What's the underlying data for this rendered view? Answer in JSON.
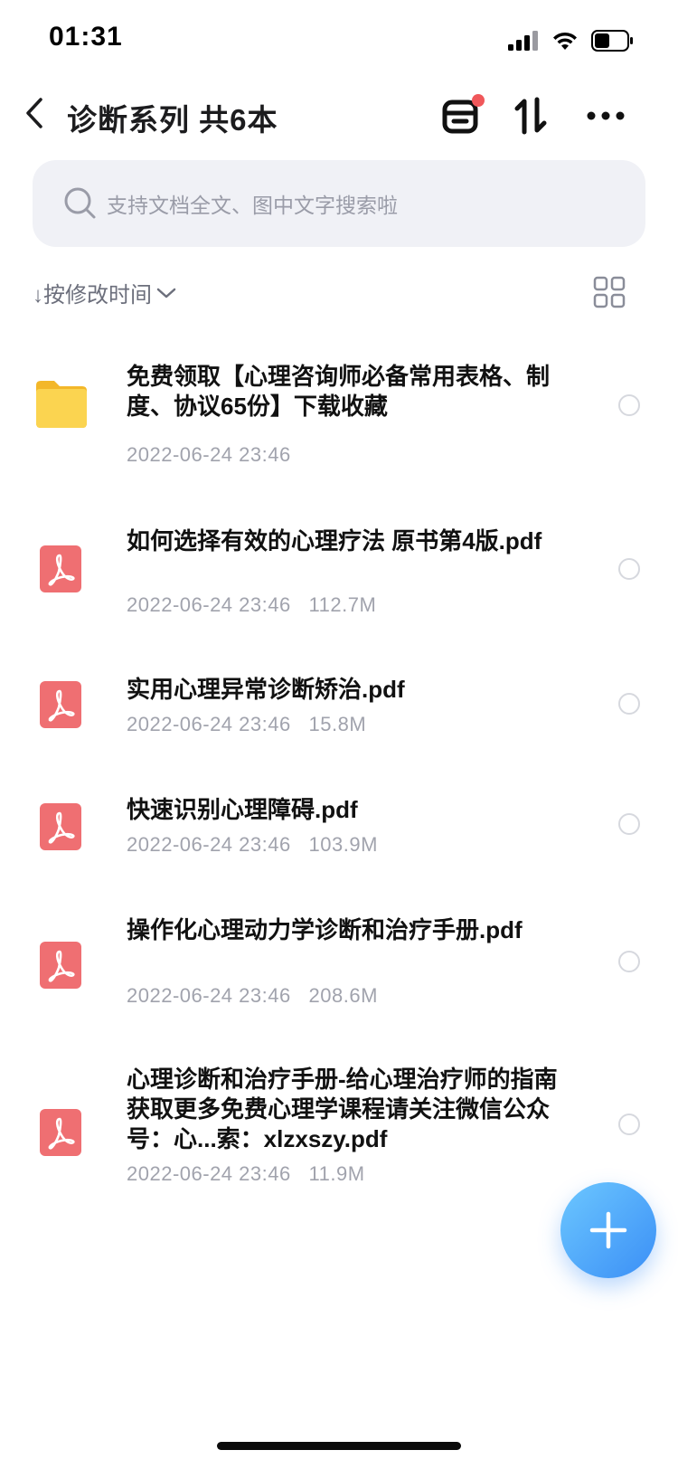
{
  "status_bar": {
    "time": "01:31"
  },
  "header": {
    "title": "诊断系列 共6本"
  },
  "search": {
    "placeholder": "支持文档全文、图中文字搜索啦"
  },
  "sort": {
    "label": "↓按修改时间"
  },
  "files": [
    {
      "type": "folder",
      "name": "免费领取【心理咨询师必备常用表格、制度、协议65份】下载收藏",
      "date": "2022-06-24 23:46",
      "size": ""
    },
    {
      "type": "pdf",
      "name": "如何选择有效的心理疗法 原书第4版.pdf",
      "date": "2022-06-24 23:46",
      "size": "112.7M"
    },
    {
      "type": "pdf",
      "name": "实用心理异常诊断矫治.pdf",
      "date": "2022-06-24 23:46",
      "size": "15.8M"
    },
    {
      "type": "pdf",
      "name": "快速识别心理障碍.pdf",
      "date": "2022-06-24 23:46",
      "size": "103.9M"
    },
    {
      "type": "pdf",
      "name": "操作化心理动力学诊断和治疗手册.pdf",
      "date": "2022-06-24 23:46",
      "size": "208.6M"
    },
    {
      "type": "pdf",
      "name": "心理诊断和治疗手册-给心理治疗师的指南 获取更多免费心理学课程请关注微信公众号：心...索：xlzxszy.pdf",
      "date": "2022-06-24 23:46",
      "size": "11.9M"
    }
  ],
  "colors": {
    "pdf_icon": "#ef6f72",
    "folder_icon": "#f9c940",
    "fab": "#4aa6fb",
    "notification_dot": "#f0575a"
  }
}
